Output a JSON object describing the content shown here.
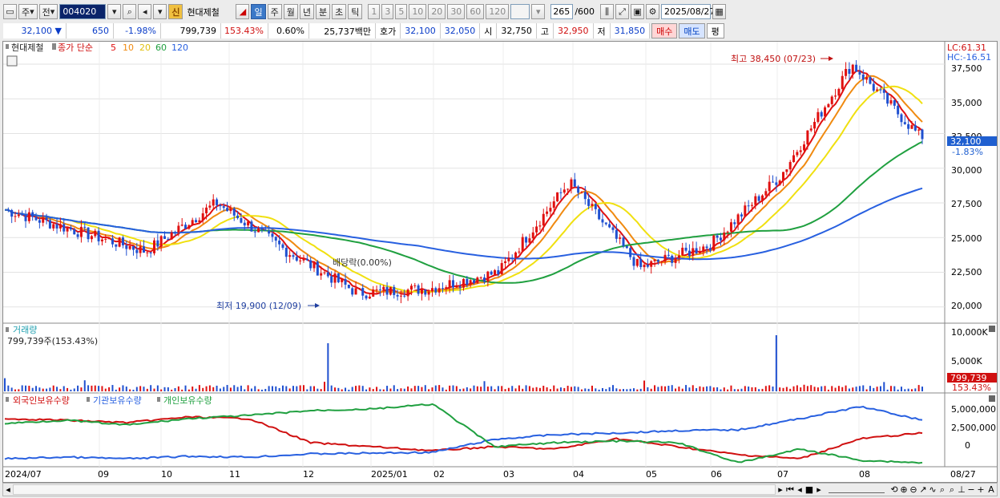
{
  "toolbar": {
    "period_label": "주",
    "prev_label": "전",
    "stock_code": "004020",
    "new_label": "신",
    "stock_name": "현대제철",
    "periods": [
      "일",
      "주",
      "월",
      "년",
      "분",
      "초",
      "틱"
    ],
    "active_period": "일",
    "intervals": [
      "1",
      "3",
      "5",
      "10",
      "20",
      "30",
      "60",
      "120"
    ],
    "count_value": "265",
    "count_total": "/600",
    "date": "2025/08/27"
  },
  "quote": {
    "price": "32,100",
    "change": "650",
    "change_pct": "-1.98%",
    "volume": "799,739",
    "volume_pct": "153.43%",
    "turnover_pct": "0.60%",
    "amount": "25,737백만",
    "bid_label": "호가",
    "bid1": "32,100",
    "bid2": "32,050",
    "open_label": "시",
    "open": "32,750",
    "high_label": "고",
    "high": "32,950",
    "low_label": "저",
    "low": "31,850",
    "buy_label": "매수",
    "sell_label": "매도",
    "eval_label": "평"
  },
  "price_panel": {
    "stock_name": "현대제철",
    "legend_prefix": "종가 단순",
    "ma_periods": [
      "5",
      "10",
      "20",
      "60",
      "120"
    ],
    "ma_colors": [
      "#e01010",
      "#f08a10",
      "#f0e010",
      "#20a040",
      "#2860e0"
    ],
    "lc_label": "LC:61.31",
    "hc_label": "HC:-16.51",
    "y_ticks": [
      "37,500",
      "35,000",
      "32,500",
      "30,000",
      "27,500",
      "25,000",
      "22,500",
      "20,000"
    ],
    "current_price_tag": "32,100",
    "current_change_tag": "-1.83%",
    "high_annotation": "최고 38,450 (07/23)",
    "low_annotation": "최저 19,900 (12/09)",
    "dividend_annotation": "배당락(0.00%)"
  },
  "volume_panel": {
    "title": "거래량",
    "summary": "799,739주(153.43%)",
    "y_ticks": [
      "10,000K",
      "5,000K"
    ],
    "value_tag": "799,739",
    "pct_tag": "153.43%"
  },
  "holdings_panel": {
    "legend": [
      "외국인보유수량",
      "기관보유수량",
      "개인보유수량"
    ],
    "colors": [
      "#d01010",
      "#2860e0",
      "#20a040"
    ],
    "y_ticks": [
      "5,000,000",
      "2,500,000",
      "0"
    ]
  },
  "x_axis": {
    "labels": [
      "2024/07",
      "09",
      "10",
      "11",
      "12",
      "2025/01",
      "02",
      "03",
      "04",
      "05",
      "06",
      "07",
      "08",
      "08/27"
    ]
  },
  "chart_data": {
    "type": "candlestick",
    "ylim": [
      19000,
      39000
    ],
    "high": 38450,
    "low": 19900,
    "last": 32100,
    "dates_range": [
      "2024/07",
      "2025/08/27"
    ],
    "close_path_monthly": [
      {
        "x": "2024/07",
        "close": 27000
      },
      {
        "x": "08",
        "close": 25500
      },
      {
        "x": "09",
        "close": 24000
      },
      {
        "x": "10",
        "close": 27500
      },
      {
        "x": "11",
        "close": 24000
      },
      {
        "x": "12",
        "close": 21000
      },
      {
        "x": "2025/01",
        "close": 21300
      },
      {
        "x": "02",
        "close": 22500
      },
      {
        "x": "03",
        "close": 29000
      },
      {
        "x": "04",
        "close": 22800
      },
      {
        "x": "05",
        "close": 24500
      },
      {
        "x": "06",
        "close": 29500
      },
      {
        "x": "07",
        "close": 37500
      },
      {
        "x": "08",
        "close": 32100
      }
    ]
  }
}
